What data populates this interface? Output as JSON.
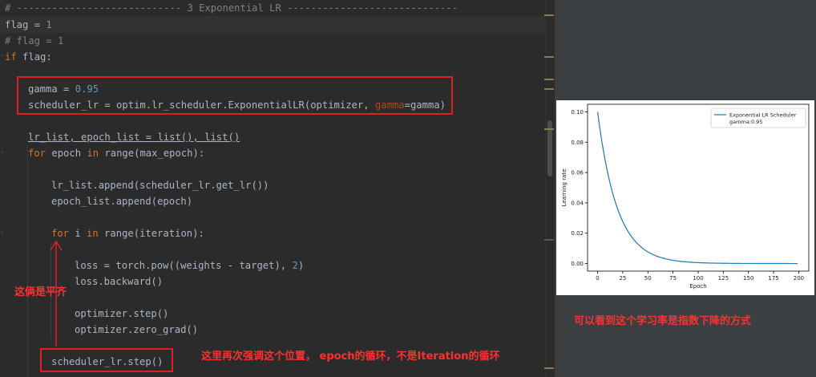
{
  "editor": {
    "lines": {
      "header": "# ---------------------------- 3 Exponential LR -----------------------------",
      "flag_var": "flag",
      "flag_eq": " = ",
      "flag_val": "1",
      "flag_comment": "# flag = 1",
      "if_kw": "if",
      "if_rest": " flag:",
      "gamma_var": "gamma",
      "gamma_eq": " = ",
      "gamma_val": "0.95",
      "sched_prefix": "scheduler_lr = optim.lr_scheduler.ExponentialLR(optimizer, ",
      "sched_kwarg": "gamma",
      "sched_suffix": "=gamma)",
      "lists_a": "lr_list, epoch_list = ",
      "lists_b": "list(), list()",
      "for_epoch_kw1": "for",
      "for_epoch_mid": " epoch ",
      "for_epoch_kw2": "in",
      "for_epoch_rest": " range(max_epoch):",
      "append_lr": "lr_list.append(scheduler_lr.get_lr())",
      "append_epoch": "epoch_list.append(epoch)",
      "for_i_kw1": "for",
      "for_i_mid": " i ",
      "for_i_kw2": "in",
      "for_i_rest": " range(iteration):",
      "loss_a": "loss = torch.pow((weights - target), ",
      "loss_num": "2",
      "loss_b": ")",
      "backward": "loss.backward()",
      "opt_step": "optimizer.step()",
      "zero_grad": "optimizer.zero_grad()",
      "sched_step": "scheduler_lr.step()"
    }
  },
  "annotations": {
    "aligned": "这俩是平齐",
    "emphasis": "这里再次强调这个位置， epoch的循环，不是Iteration的循环",
    "conclusion": "可以看到这个学习率是指数下降的方式"
  },
  "colors": {
    "annotation_red": "#e02020",
    "line_blue": "#1f77b4",
    "keyword": "#cc7832",
    "number": "#6897bb"
  },
  "chart_data": {
    "type": "line",
    "title": "",
    "xlabel": "Epoch",
    "ylabel": "Learning rate",
    "xlim": [
      -10,
      210
    ],
    "ylim": [
      -0.005,
      0.105
    ],
    "xticks": [
      "0",
      "25",
      "50",
      "75",
      "100",
      "125",
      "150",
      "175",
      "200"
    ],
    "yticks": [
      "0.00",
      "0.02",
      "0.04",
      "0.06",
      "0.08",
      "0.10"
    ],
    "legend_position": "top-right",
    "series": [
      {
        "name": "Exponential LR Scheduler\ngamma:0.95",
        "legend_line1": "Exponential LR Scheduler",
        "legend_line2": "gamma:0.95",
        "initial_lr": 0.1,
        "gamma": 0.95,
        "x_start": 0,
        "x_end": 199
      }
    ]
  }
}
